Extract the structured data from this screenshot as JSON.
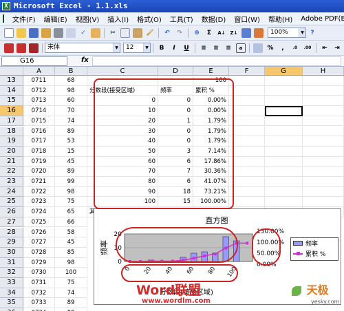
{
  "window": {
    "title": "Microsoft Excel - 1.1.xls"
  },
  "menu": [
    "文件(F)",
    "编辑(E)",
    "视图(V)",
    "插入(I)",
    "格式(O)",
    "工具(T)",
    "数据(D)",
    "窗口(W)",
    "帮助(H)",
    "Adobe PDF(B)"
  ],
  "toolbar": {
    "zoom": "100%",
    "font_name": "宋体",
    "font_size": "12",
    "bold": "B",
    "italic": "I",
    "underline": "U",
    "percent": "%"
  },
  "formula": {
    "name_box": "G16",
    "fx": "fx",
    "value": ""
  },
  "columns": [
    "A",
    "B",
    "C",
    "D",
    "E",
    "F",
    "G",
    "H"
  ],
  "rows": [
    {
      "n": "13",
      "a": "0711",
      "b": "68",
      "c": "",
      "d": "",
      "e": "100"
    },
    {
      "n": "14",
      "a": "0712",
      "b": "98",
      "c": "分数段(接受区域)",
      "d": "频率",
      "e": "累积 %"
    },
    {
      "n": "15",
      "a": "0713",
      "b": "60",
      "c": "0",
      "d": "0",
      "e": "0.00%"
    },
    {
      "n": "16",
      "a": "0714",
      "b": "70",
      "c": "10",
      "d": "0",
      "e": "0.00%"
    },
    {
      "n": "17",
      "a": "0715",
      "b": "74",
      "c": "20",
      "d": "1",
      "e": "1.79%"
    },
    {
      "n": "18",
      "a": "0716",
      "b": "89",
      "c": "30",
      "d": "0",
      "e": "1.79%"
    },
    {
      "n": "19",
      "a": "0717",
      "b": "53",
      "c": "40",
      "d": "0",
      "e": "1.79%"
    },
    {
      "n": "20",
      "a": "0718",
      "b": "15",
      "c": "50",
      "d": "3",
      "e": "7.14%"
    },
    {
      "n": "21",
      "a": "0719",
      "b": "45",
      "c": "60",
      "d": "6",
      "e": "17.86%"
    },
    {
      "n": "22",
      "a": "0720",
      "b": "89",
      "c": "70",
      "d": "7",
      "e": "30.36%"
    },
    {
      "n": "23",
      "a": "0721",
      "b": "99",
      "c": "80",
      "d": "6",
      "e": "41.07%"
    },
    {
      "n": "24",
      "a": "0722",
      "b": "98",
      "c": "90",
      "d": "18",
      "e": "73.21%"
    },
    {
      "n": "25",
      "a": "0723",
      "b": "75",
      "c": "100",
      "d": "15",
      "e": "100.00%"
    },
    {
      "n": "26",
      "a": "0724",
      "b": "65",
      "c": "其他",
      "d": "0",
      "e": "100.00%"
    },
    {
      "n": "27",
      "a": "0725",
      "b": "66",
      "c": "",
      "d": "",
      "e": ""
    },
    {
      "n": "28",
      "a": "0726",
      "b": "58",
      "c": "",
      "d": "",
      "e": ""
    },
    {
      "n": "29",
      "a": "0727",
      "b": "45",
      "c": "",
      "d": "",
      "e": ""
    },
    {
      "n": "30",
      "a": "0728",
      "b": "85",
      "c": "",
      "d": "",
      "e": ""
    },
    {
      "n": "31",
      "a": "0729",
      "b": "98",
      "c": "",
      "d": "",
      "e": ""
    },
    {
      "n": "32",
      "a": "0730",
      "b": "100",
      "c": "",
      "d": "",
      "e": ""
    },
    {
      "n": "33",
      "a": "0731",
      "b": "75",
      "c": "",
      "d": "",
      "e": ""
    },
    {
      "n": "34",
      "a": "0732",
      "b": "74",
      "c": "",
      "d": "",
      "e": ""
    },
    {
      "n": "35",
      "a": "0733",
      "b": "89",
      "c": "",
      "d": "",
      "e": ""
    },
    {
      "n": "36",
      "a": "0734",
      "b": "89",
      "c": "",
      "d": "",
      "e": ""
    }
  ],
  "chart_data": {
    "type": "bar",
    "title": "直方图",
    "xlabel": "分数段(接受区域)",
    "ylabel": "频率",
    "categories": [
      "0",
      "10",
      "20",
      "30",
      "40",
      "50",
      "60",
      "70",
      "80",
      "90",
      "100",
      "其他"
    ],
    "x_tick_labels": [
      "0",
      "20",
      "40",
      "60",
      "80",
      "100"
    ],
    "y_ticks": [
      "0",
      "10",
      "20"
    ],
    "y2_ticks": [
      "150.00%",
      "100.00%",
      "50.00%",
      "0.00%"
    ],
    "ylim": [
      0,
      20
    ],
    "y2lim": [
      0,
      150
    ],
    "series": [
      {
        "name": "频率",
        "kind": "bar",
        "color": "#9999ff",
        "values": [
          0,
          0,
          1,
          0,
          0,
          3,
          6,
          7,
          6,
          18,
          15,
          0
        ]
      },
      {
        "name": "累积 %",
        "kind": "line",
        "color": "#cc33cc",
        "values": [
          0,
          0,
          1.79,
          1.79,
          1.79,
          7.14,
          17.86,
          30.36,
          41.07,
          73.21,
          100,
          100
        ]
      }
    ],
    "legend_position": "right",
    "plot_background": "#c0c0c0"
  },
  "watermarks": {
    "logo": "Word联盟",
    "url": "www.wordlm.com",
    "brand": "天极",
    "brand_url": "yesky.com"
  }
}
